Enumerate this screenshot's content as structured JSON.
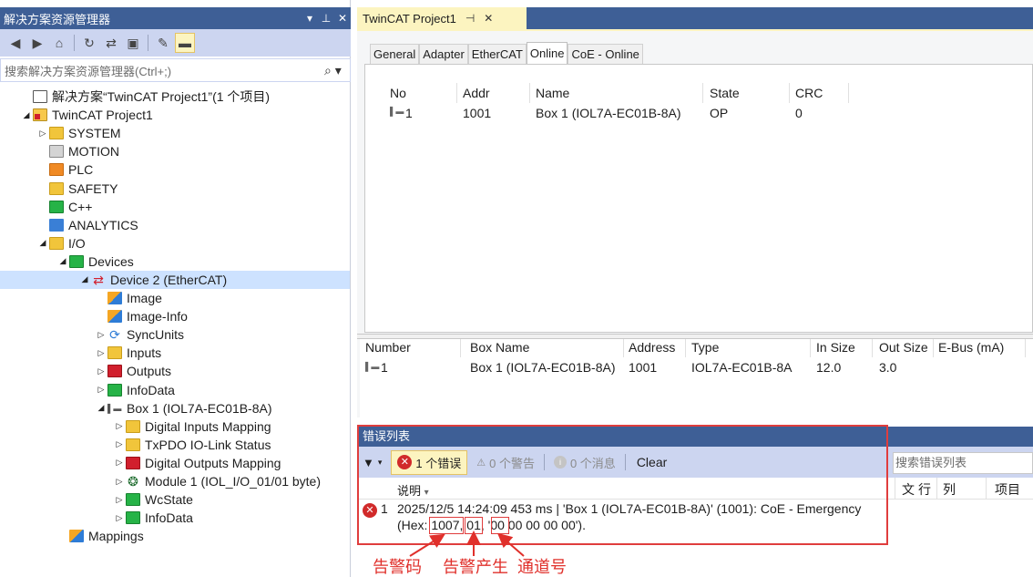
{
  "solution_explorer": {
    "title": "解决方案资源管理器",
    "title_buttons": [
      "▾",
      "⊥",
      "✕"
    ],
    "search_placeholder": "搜索解决方案资源管理器(Ctrl+;)",
    "tree": [
      {
        "label": "解决方案“TwinCAT Project1”(1 个项目)",
        "depth": 0,
        "icon": "solution-icon",
        "twisty": ""
      },
      {
        "label": "TwinCAT Project1",
        "depth": 0,
        "icon": "twincat-project-icon",
        "twisty": "◢"
      },
      {
        "label": "SYSTEM",
        "depth": 1,
        "icon": "system-icon",
        "twisty": "▷"
      },
      {
        "label": "MOTION",
        "depth": 1,
        "icon": "motion-icon",
        "twisty": ""
      },
      {
        "label": "PLC",
        "depth": 1,
        "icon": "plc-icon",
        "twisty": ""
      },
      {
        "label": "SAFETY",
        "depth": 1,
        "icon": "safety-icon",
        "twisty": ""
      },
      {
        "label": "C++",
        "depth": 1,
        "icon": "cpp-icon",
        "twisty": ""
      },
      {
        "label": "ANALYTICS",
        "depth": 1,
        "icon": "analytics-icon",
        "twisty": ""
      },
      {
        "label": "I/O",
        "depth": 1,
        "icon": "io-icon",
        "twisty": "◢"
      },
      {
        "label": "Devices",
        "depth": 2,
        "icon": "devices-icon",
        "twisty": "◢"
      },
      {
        "label": "Device 2 (EtherCAT)",
        "depth": 3,
        "icon": "ethercat-device-icon",
        "twisty": "◢",
        "selected": true
      },
      {
        "label": "Image",
        "depth": 4,
        "icon": "image-icon",
        "twisty": ""
      },
      {
        "label": "Image-Info",
        "depth": 4,
        "icon": "image-info-icon",
        "twisty": ""
      },
      {
        "label": "SyncUnits",
        "depth": 4,
        "icon": "syncunits-icon",
        "twisty": "▷"
      },
      {
        "label": "Inputs",
        "depth": 4,
        "icon": "inputs-icon",
        "twisty": "▷"
      },
      {
        "label": "Outputs",
        "depth": 4,
        "icon": "outputs-icon",
        "twisty": "▷"
      },
      {
        "label": "InfoData",
        "depth": 4,
        "icon": "infodata-icon",
        "twisty": "▷"
      },
      {
        "label": "Box 1 (IOL7A-EC01B-8A)",
        "depth": 4,
        "icon": "box-icon",
        "twisty": "◢"
      },
      {
        "label": "Digital Inputs Mapping",
        "depth": 5,
        "icon": "digital-inputs-icon",
        "twisty": "▷"
      },
      {
        "label": "TxPDO IO-Link Status",
        "depth": 5,
        "icon": "txpdo-icon",
        "twisty": "▷"
      },
      {
        "label": "Digital Outputs Mapping",
        "depth": 5,
        "icon": "digital-outputs-icon",
        "twisty": "▷"
      },
      {
        "label": "Module 1 (IOL_I/O_01/01 byte)",
        "depth": 5,
        "icon": "module-icon",
        "twisty": "▷"
      },
      {
        "label": "WcState",
        "depth": 5,
        "icon": "wcstate-icon",
        "twisty": "▷"
      },
      {
        "label": "InfoData",
        "depth": 5,
        "icon": "infodata-icon",
        "twisty": "▷"
      },
      {
        "label": "Mappings",
        "depth": 2,
        "icon": "mappings-icon",
        "twisty": ""
      }
    ]
  },
  "document": {
    "tab_title": "TwinCAT Project1",
    "tab_pin": "⊣",
    "tab_close": "✕",
    "tabs": [
      "General",
      "Adapter",
      "EtherCAT",
      "Online",
      "CoE - Online"
    ],
    "active_tab": "Online",
    "online_table": {
      "headers": [
        "No",
        "Addr",
        "Name",
        "State",
        "CRC"
      ],
      "rows": [
        {
          "no": "1",
          "addr": "1001",
          "name": "Box 1 (IOL7A-EC01B-8A)",
          "state": "OP",
          "crc": "0"
        }
      ]
    },
    "box_table": {
      "headers": [
        "Number",
        "Box Name",
        "Address",
        "Type",
        "In Size",
        "Out Size",
        "E-Bus (mA)"
      ],
      "rows": [
        {
          "number": "1",
          "box_name": "Box 1 (IOL7A-EC01B-8A)",
          "address": "1001",
          "type": "IOL7A-EC01B-8A",
          "in_size": "12.0",
          "out_size": "3.0",
          "ebus": ""
        }
      ]
    }
  },
  "error_list": {
    "title": "错误列表",
    "errors_btn": "1 个错误",
    "warnings_btn": "0 个警告",
    "messages_btn": "0 个消息",
    "clear_btn": "Clear",
    "search_placeholder": "搜索错误列表",
    "col_desc": "说明",
    "col_file": "文",
    "col_line": "行",
    "col_col": "列",
    "col_project": "项目",
    "row": {
      "index": "1",
      "line1": "2025/12/5 14:24:09 453 ms | 'Box 1 (IOL7A-EC01B-8A)' (1001): CoE - Emergency",
      "hex_prefix": "(Hex: ",
      "code": "1007",
      "sep1": ", ",
      "occur": "01",
      "sep2": ", '",
      "channel": "00",
      "hex_rest": " 00 00 00 00')."
    }
  },
  "annotations": {
    "alarm_code": "告警码",
    "alarm_occur": "告警产生",
    "channel_no": "通道号",
    "color": "#e0302b"
  }
}
